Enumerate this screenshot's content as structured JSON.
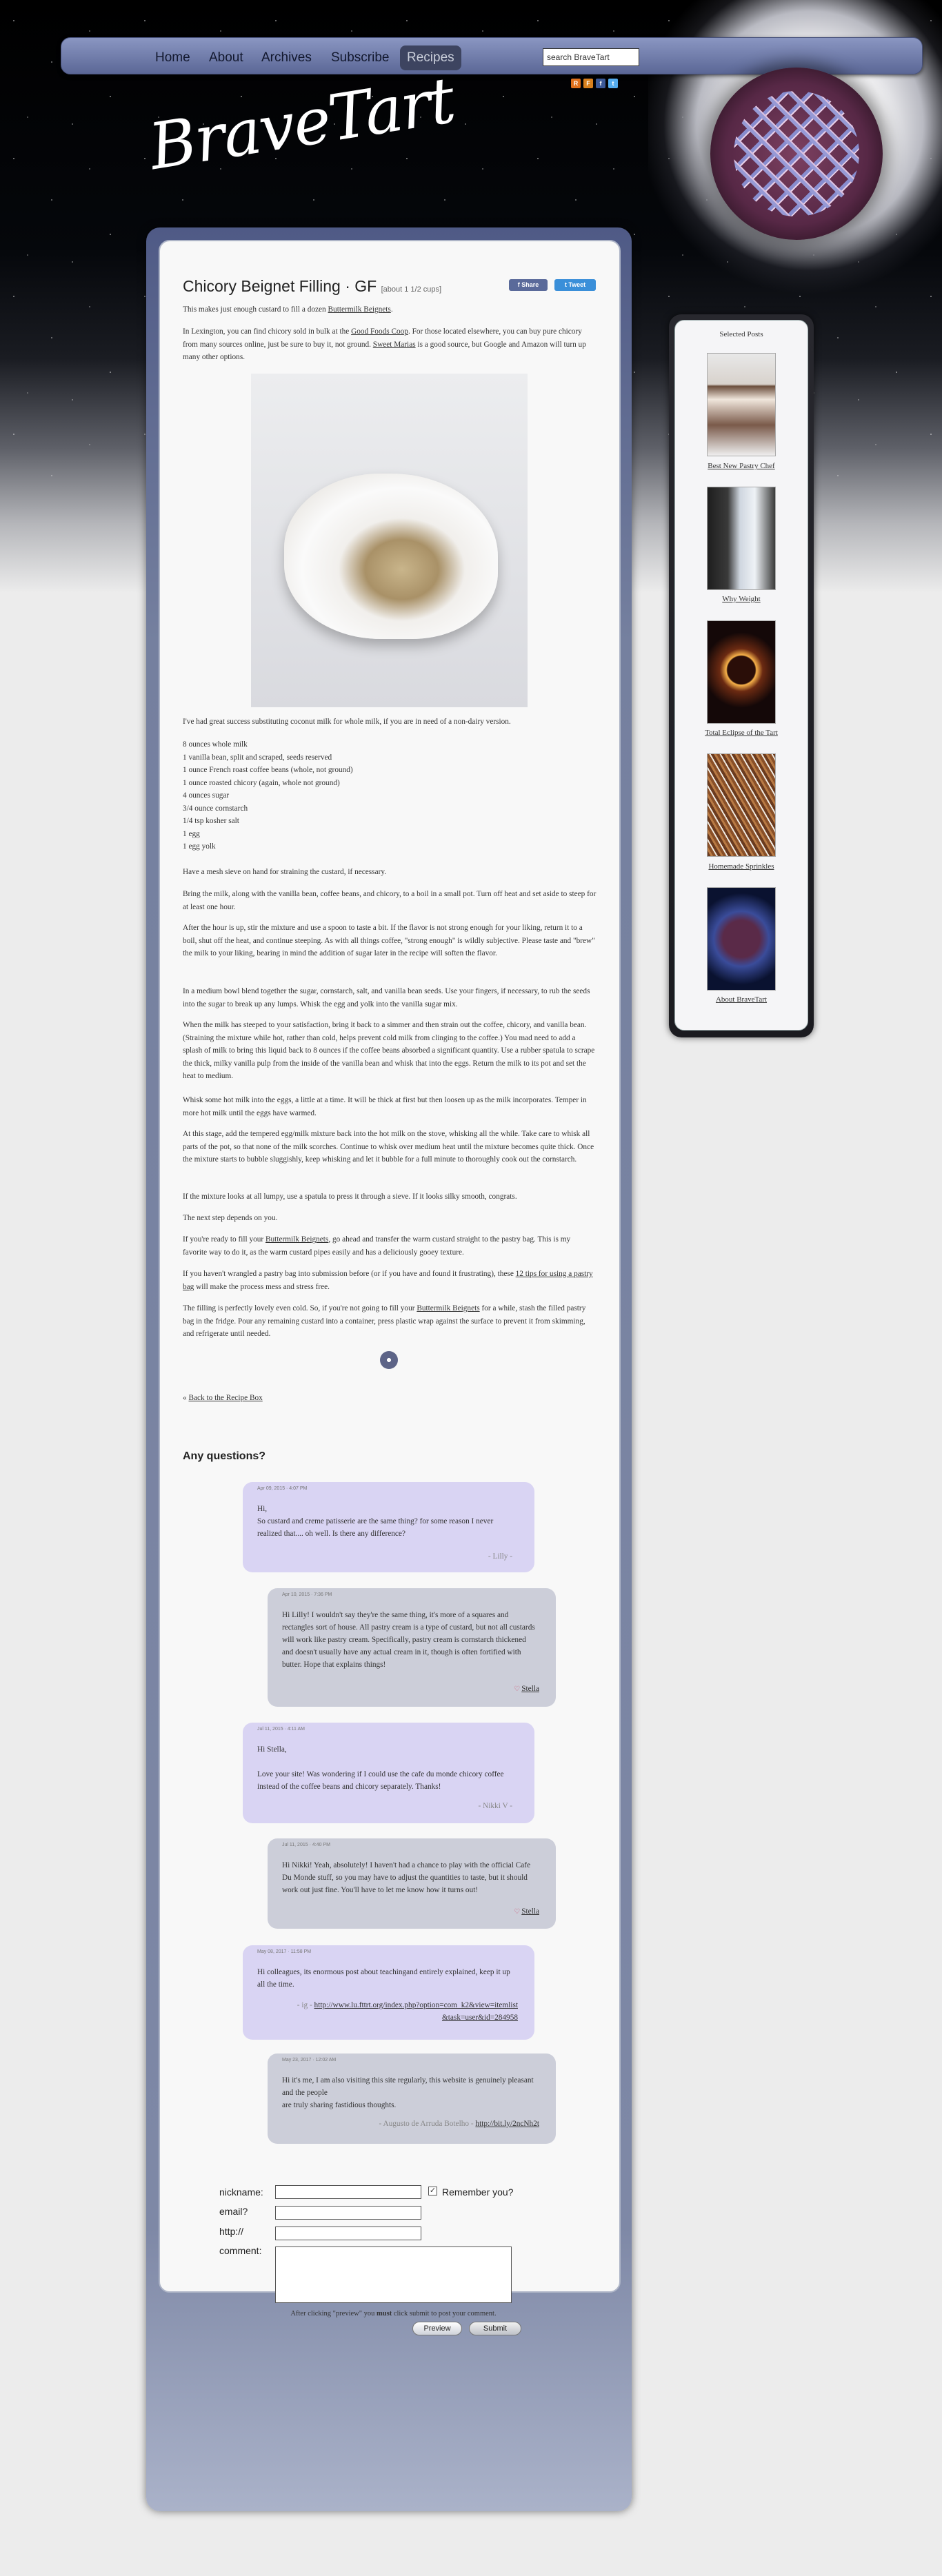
{
  "nav": {
    "items": [
      "Home",
      "About",
      "Archives",
      "Subscribe",
      "Recipes"
    ],
    "active": "Recipes",
    "search_placeholder": "search BraveTart"
  },
  "logo_text": "BraveTart",
  "post": {
    "title": "Chicory Beignet Filling · GF",
    "yield": "[about 1 1/2 cups]",
    "share_label": "Share",
    "tweet_label": "Tweet",
    "intro_a": "This makes just enough custard to fill a dozen ",
    "intro_link": "Buttermilk Beignets",
    "intro_b": ".",
    "p2_a": "In Lexington, you can find chicory sold in bulk at the ",
    "p2_link1": "Good Foods Coop",
    "p2_b": ". For those located elsewhere, you can buy pure chicory from many sources online, just be sure to buy it, not ground. ",
    "p2_link2": "Sweet Marias",
    "p2_c": " is a good source, but Google and Amazon will turn up many other options.",
    "p3": "I've had great success substituting coconut milk for whole milk, if you are in need of a non-dairy version.",
    "ingredients": [
      "8 ounces whole milk",
      "1 vanilla bean, split and scraped, seeds reserved",
      "1 ounce French roast coffee beans (whole, not ground)",
      "1 ounce roasted chicory (again, whole not ground)",
      "4 ounces sugar",
      "3/4 ounce cornstarch",
      "1/4 tsp kosher salt",
      "1 egg",
      "1 egg yolk"
    ],
    "steps": [
      "Have a mesh sieve on hand for straining the custard, if necessary.",
      "Bring the milk, along with the vanilla bean, coffee beans, and chicory, to a boil in a small pot. Turn off heat and set aside to steep for at least one hour.",
      "After the hour is up, stir the mixture and use a spoon to taste a bit. If the flavor is not strong enough for your liking, return it to a boil, shut off the heat, and continue steeping. As with all things coffee, \"strong enough\" is wildly subjective. Please taste and \"brew\" the milk to your liking, bearing in mind the addition of sugar later in the recipe will soften the flavor.",
      "In a medium bowl blend together the sugar, cornstarch, salt, and vanilla bean seeds. Use your fingers, if necessary, to rub the seeds into the sugar to break up any lumps. Whisk the egg and yolk into the vanilla sugar mix.",
      "When the milk has steeped to your satisfaction, bring it back to a simmer and then strain out the coffee, chicory, and vanilla bean. (Straining the mixture while hot, rather than cold, helps prevent cold milk from clinging to the coffee.) You mad need to add a splash of milk to bring this liquid back to 8 ounces if the coffee beans absorbed a significant quantity. Use a rubber spatula to scrape the thick, milky vanilla pulp from the inside of the vanilla bean and whisk that into the eggs. Return the milk to its pot and set the heat to medium.",
      "Whisk some hot milk into the eggs, a little at a time. It will be thick at first but then loosen up as the milk incorporates. Temper in more hot milk until the eggs have warmed.",
      "At this stage, add the tempered egg/milk mixture back into the hot milk on the stove, whisking all the while. Take care to whisk all parts of the pot, so that none of the milk scorches. Continue to whisk over medium heat until the mixture becomes quite thick. Once the mixture starts to bubble sluggishly, keep whisking and let it bubble for a full minute to thoroughly cook out the cornstarch.",
      "If the mixture looks at all lumpy, use a spatula to press it through a sieve. If it looks silky smooth, congrats.",
      "The next step depends on you."
    ],
    "p_a1": "If you're ready to fill your ",
    "p_a_link": "Buttermilk Beignets",
    "p_a2": ", go ahead and transfer the warm custard straight to the pastry bag. This is my favorite way to do it, as the warm custard pipes easily and has a deliciously gooey texture.",
    "p_b1": "If you haven't wrangled a pastry bag into submission before (or if you have and found it frustrating), these ",
    "p_b_link": "12 tips for using a pastry bag",
    "p_b2": " will make the process mess and stress free.",
    "p_c1": "The filling is perfectly lovely even cold. So, if you're not going to fill your ",
    "p_c_link": "Buttermilk Beignets",
    "p_c2": " for a while, stash the filled pastry bag in the fridge. Pour any remaining custard into a container, press plastic wrap against the surface to prevent it from skimming, and refrigerate until needed.",
    "back_prefix": "« ",
    "back_link": "Back to the Recipe Box"
  },
  "comments_heading": "Any questions?",
  "comments": [
    {
      "meta": "Apr 09, 2015 · 4:07 PM",
      "text": "Hi,\nSo custard and creme patisserie are the same thing? for some reason I never realized that.... oh well. Is there any difference?",
      "sig": "- Lilly -"
    },
    {
      "meta": "Apr 10, 2015 · 7:36 PM",
      "text": "Hi Lilly! I wouldn't say they're the same thing, it's more of a squares and rectangles sort of house. All pastry cream is a type of custard, but not all custards will work like pastry cream. Specifically, pastry cream is cornstarch thickened and doesn't usually have any actual cream in it, though is often fortified with butter. Hope that explains things!",
      "author": "Stella"
    },
    {
      "meta": "Jul 11, 2015 · 4:11 AM",
      "text": "Hi Stella,\n\nLove your site! Was wondering if I could use the cafe du monde chicory coffee instead of the coffee beans and chicory separately. Thanks!",
      "sig": "- Nikki V -"
    },
    {
      "meta": "Jul 11, 2015 · 4:40 PM",
      "text": "Hi Nikki! Yeah, absolutely! I haven't had a chance to play with the official Cafe Du Monde stuff, so you may have to adjust the quantities to taste, but it should work out just fine. You'll have to let me know how it turns out!",
      "author": "Stella"
    },
    {
      "meta": "May 08, 2017 · 11:58 PM",
      "text": "Hi colleagues, its enormous post about teachingand entirely explained, keep it up all the time.",
      "sig_prefix": "- ig - ",
      "link": "http://www.lu.fttrt.org/index.php?option=com_k2&view=itemlist&task=user&id=284958"
    },
    {
      "meta": "May 23, 2017 · 12:02 AM",
      "text": "Hi it's me, I am also visiting this site regularly, this website is genuinely pleasant and the people\nare truly sharing fastidious thoughts.",
      "sig_prefix": "- Augusto de Arruda Botelho - ",
      "link": "http://bit.ly/2ncNh2t"
    }
  ],
  "form": {
    "nickname": "nickname:",
    "email": "email?",
    "http": "http://",
    "comment": "comment:",
    "remember": "Remember you?",
    "note_a": "After clicking \"preview\" you ",
    "note_b": "must",
    "note_c": " click submit to post your comment.",
    "preview": "Preview",
    "submit": "Submit"
  },
  "sidebar": {
    "title": "Selected Posts",
    "items": [
      "Best New Pastry Chef",
      "Why Weight",
      "Total Eclipse of the Tart",
      "Homemade Sprinkles",
      "About BraveTart"
    ]
  }
}
